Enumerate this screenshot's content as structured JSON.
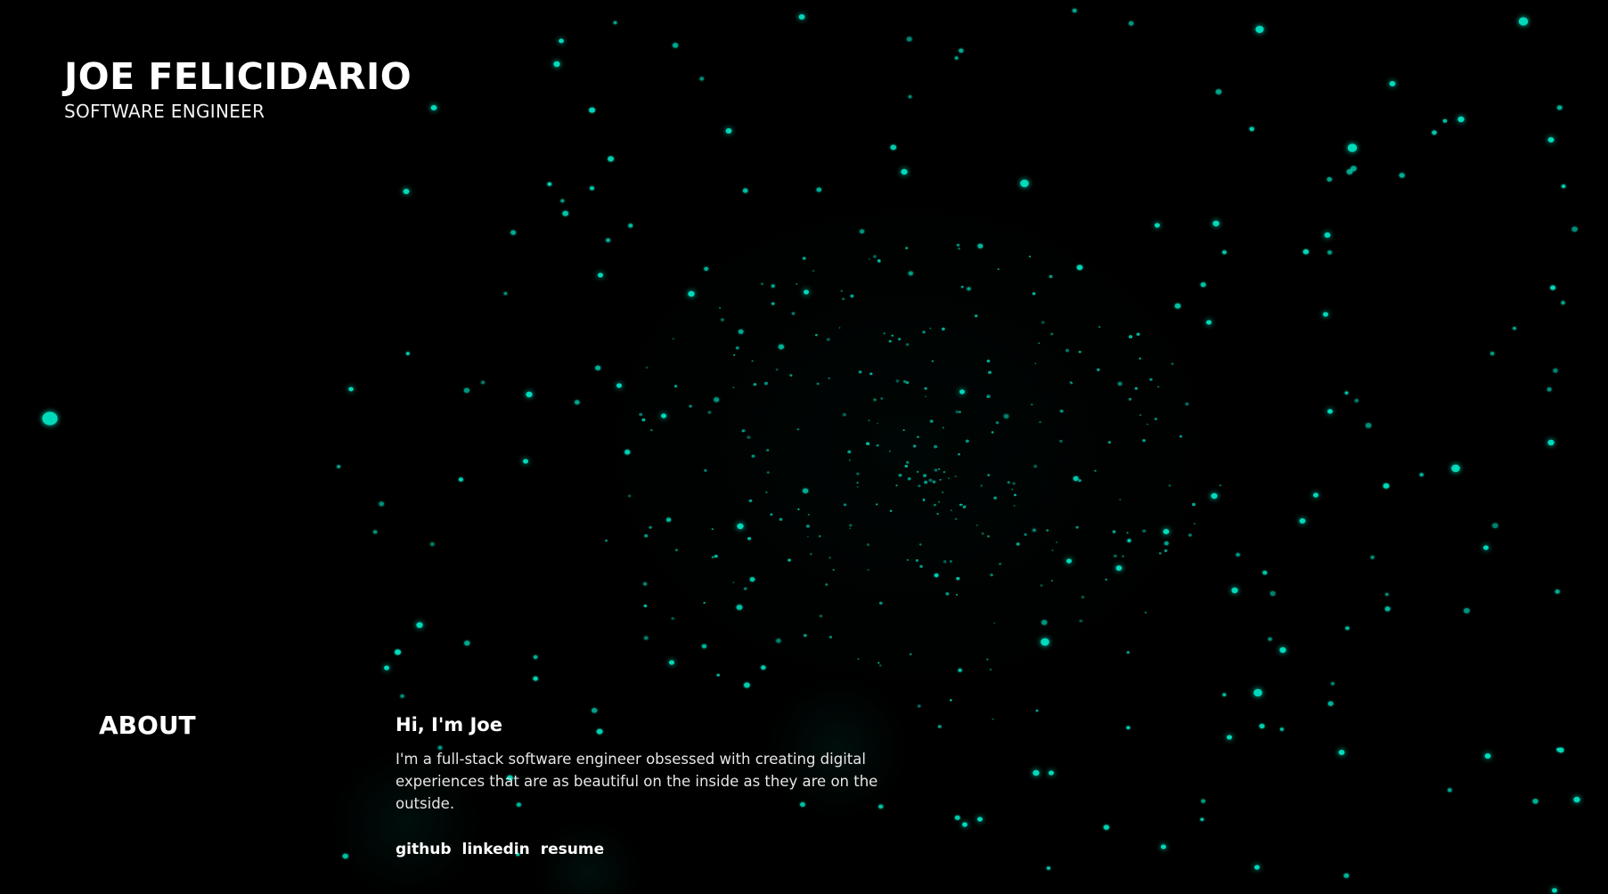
{
  "header": {
    "name": "JOE FELICIDARIO",
    "role": "SOFTWARE ENGINEER"
  },
  "about": {
    "heading": "ABOUT",
    "greeting": "Hi, I'm Joe",
    "bio": "I'm a full-stack software engineer obsessed with creating digital experiences that are as beautiful on the inside as they are on the outside.",
    "links": [
      {
        "label": "github"
      },
      {
        "label": "linkedin"
      },
      {
        "label": "resume"
      }
    ]
  },
  "theme": {
    "background": "#000000",
    "particle_color": "#00e5c4",
    "text_color": "#ffffff"
  }
}
